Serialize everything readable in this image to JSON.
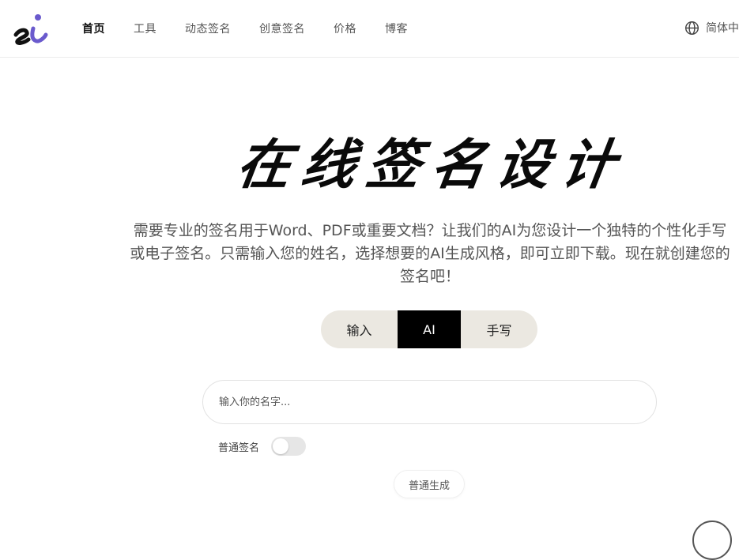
{
  "header": {
    "logo_alt": "si",
    "nav": [
      {
        "label": "首页",
        "active": true
      },
      {
        "label": "工具",
        "active": false
      },
      {
        "label": "动态签名",
        "active": false
      },
      {
        "label": "创意签名",
        "active": false
      },
      {
        "label": "价格",
        "active": false
      },
      {
        "label": "博客",
        "active": false
      }
    ],
    "language": "简体中"
  },
  "hero": {
    "title": "在线签名设计",
    "description": "需要专业的签名用于Word、PDF或重要文档？让我们的AI为您设计一个独特的个性化手写或电子签名。只需输入您的姓名，选择想要的AI生成风格，即可立即下载。现在就创建您的签名吧！"
  },
  "tabs": [
    {
      "label": "输入",
      "active": false
    },
    {
      "label": "AI",
      "active": true
    },
    {
      "label": "手写",
      "active": false
    }
  ],
  "form": {
    "name_placeholder": "输入你的名字...",
    "name_value": "",
    "toggle_label": "普通签名",
    "toggle_on": false,
    "generate_label": "普通生成"
  },
  "colors": {
    "accent": "#000000",
    "tab_bg": "#ebe8e1",
    "logo_i": "#6a5acd"
  }
}
